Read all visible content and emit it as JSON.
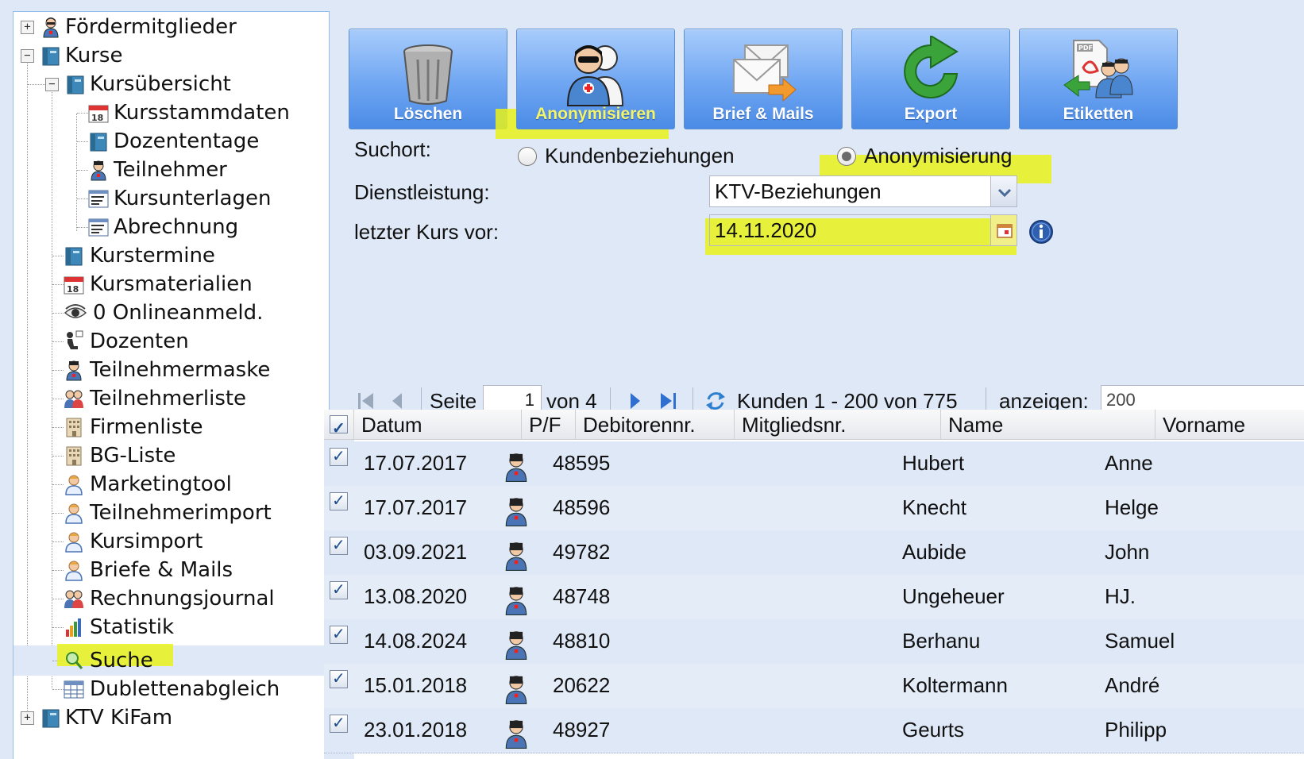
{
  "sidebar": {
    "items": [
      {
        "label": "Fördermitglieder",
        "icon": "person-icon",
        "level": 0,
        "expander": "+"
      },
      {
        "label": "Kurse",
        "icon": "book-icon",
        "level": 0,
        "expander": "-"
      },
      {
        "label": "Kursübersicht",
        "icon": "book-icon",
        "level": 1,
        "expander": "-"
      },
      {
        "label": "Kursstammdaten",
        "icon": "calendar-icon",
        "level": 2
      },
      {
        "label": "Dozententage",
        "icon": "book-icon",
        "level": 2
      },
      {
        "label": "Teilnehmer",
        "icon": "person-icon",
        "level": 2
      },
      {
        "label": "Kursunterlagen",
        "icon": "list-icon",
        "level": 2
      },
      {
        "label": "Abrechnung",
        "icon": "list-icon",
        "level": 2
      },
      {
        "label": "Kurstermine",
        "icon": "book-icon",
        "level": 1
      },
      {
        "label": "Kursmaterialien",
        "icon": "calendar-icon",
        "level": 1
      },
      {
        "label": "0 Onlineanmeld.",
        "icon": "eye-icon",
        "level": 1
      },
      {
        "label": "Dozenten",
        "icon": "teacher-icon",
        "level": 1
      },
      {
        "label": "Teilnehmermaske",
        "icon": "person-icon",
        "level": 1
      },
      {
        "label": "Teilnehmerliste",
        "icon": "group-icon",
        "level": 1
      },
      {
        "label": "Firmenliste",
        "icon": "building-icon",
        "level": 1
      },
      {
        "label": "BG-Liste",
        "icon": "building-icon",
        "level": 1
      },
      {
        "label": "Marketingtool",
        "icon": "user-icon",
        "level": 1
      },
      {
        "label": "Teilnehmerimport",
        "icon": "user-icon",
        "level": 1
      },
      {
        "label": "Kursimport",
        "icon": "user-icon",
        "level": 1
      },
      {
        "label": "Briefe & Mails",
        "icon": "user-icon",
        "level": 1
      },
      {
        "label": "Rechnungsjournal",
        "icon": "group-icon",
        "level": 1
      },
      {
        "label": "Statistik",
        "icon": "bar-chart-icon",
        "level": 1
      },
      {
        "label": "Suche",
        "icon": "search-icon",
        "level": 1,
        "selected": true
      },
      {
        "label": "Dublettenabgleich",
        "icon": "table-icon",
        "level": 1
      },
      {
        "label": "KTV KiFam",
        "icon": "book-icon",
        "level": 0,
        "expander": "+"
      }
    ]
  },
  "toolbar": {
    "buttons": [
      {
        "label": "Löschen",
        "icon": "trash-icon"
      },
      {
        "label": "Anonymisieren",
        "icon": "anonymize-users-icon"
      },
      {
        "label": "Brief & Mails",
        "icon": "envelopes-icon"
      },
      {
        "label": "Export",
        "icon": "export-arrow-icon"
      },
      {
        "label": "Etiketten",
        "icon": "pdf-labels-icon"
      }
    ]
  },
  "form": {
    "suchort_label": "Suchort:",
    "radio_options": [
      {
        "label": "Kundenbeziehungen",
        "checked": false
      },
      {
        "label": "Anonymisierung",
        "checked": true
      }
    ],
    "dienstleistung_label": "Dienstleistung:",
    "dienstleistung_value": "KTV-Beziehungen",
    "letzter_kurs_label": "letzter Kurs vor:",
    "letzter_kurs_value": "14.11.2020"
  },
  "paging": {
    "page_label": "Seite",
    "page_value": "1",
    "of_label": "von 4",
    "records_label": "Kunden 1 - 200 von 775",
    "show_label": "anzeigen:",
    "page_size": "200"
  },
  "grid": {
    "columns": [
      "Datum",
      "P/F",
      "Debitorennr.",
      "Mitgliedsnr.",
      "Name",
      "Vorname"
    ],
    "rows": [
      {
        "datum": "17.07.2017",
        "debitor": "48595",
        "mitglied": "",
        "name": "Hubert",
        "vorname": "Anne"
      },
      {
        "datum": "17.07.2017",
        "debitor": "48596",
        "mitglied": "",
        "name": "Knecht",
        "vorname": "Helge"
      },
      {
        "datum": "03.09.2021",
        "debitor": "49782",
        "mitglied": "",
        "name": "Aubide",
        "vorname": "John"
      },
      {
        "datum": "13.08.2020",
        "debitor": "48748",
        "mitglied": "",
        "name": "Ungeheuer",
        "vorname": "HJ."
      },
      {
        "datum": "14.08.2024",
        "debitor": "48810",
        "mitglied": "",
        "name": "Berhanu",
        "vorname": "Samuel"
      },
      {
        "datum": "15.01.2018",
        "debitor": "20622",
        "mitglied": "",
        "name": "Koltermann",
        "vorname": "André"
      },
      {
        "datum": "23.01.2018",
        "debitor": "48927",
        "mitglied": "",
        "name": "Geurts",
        "vorname": "Philipp"
      }
    ]
  },
  "colors": {
    "highlight": "#e9f21a",
    "button_blue": "#6fa6f2",
    "panel_background": "#dfe8f6"
  }
}
